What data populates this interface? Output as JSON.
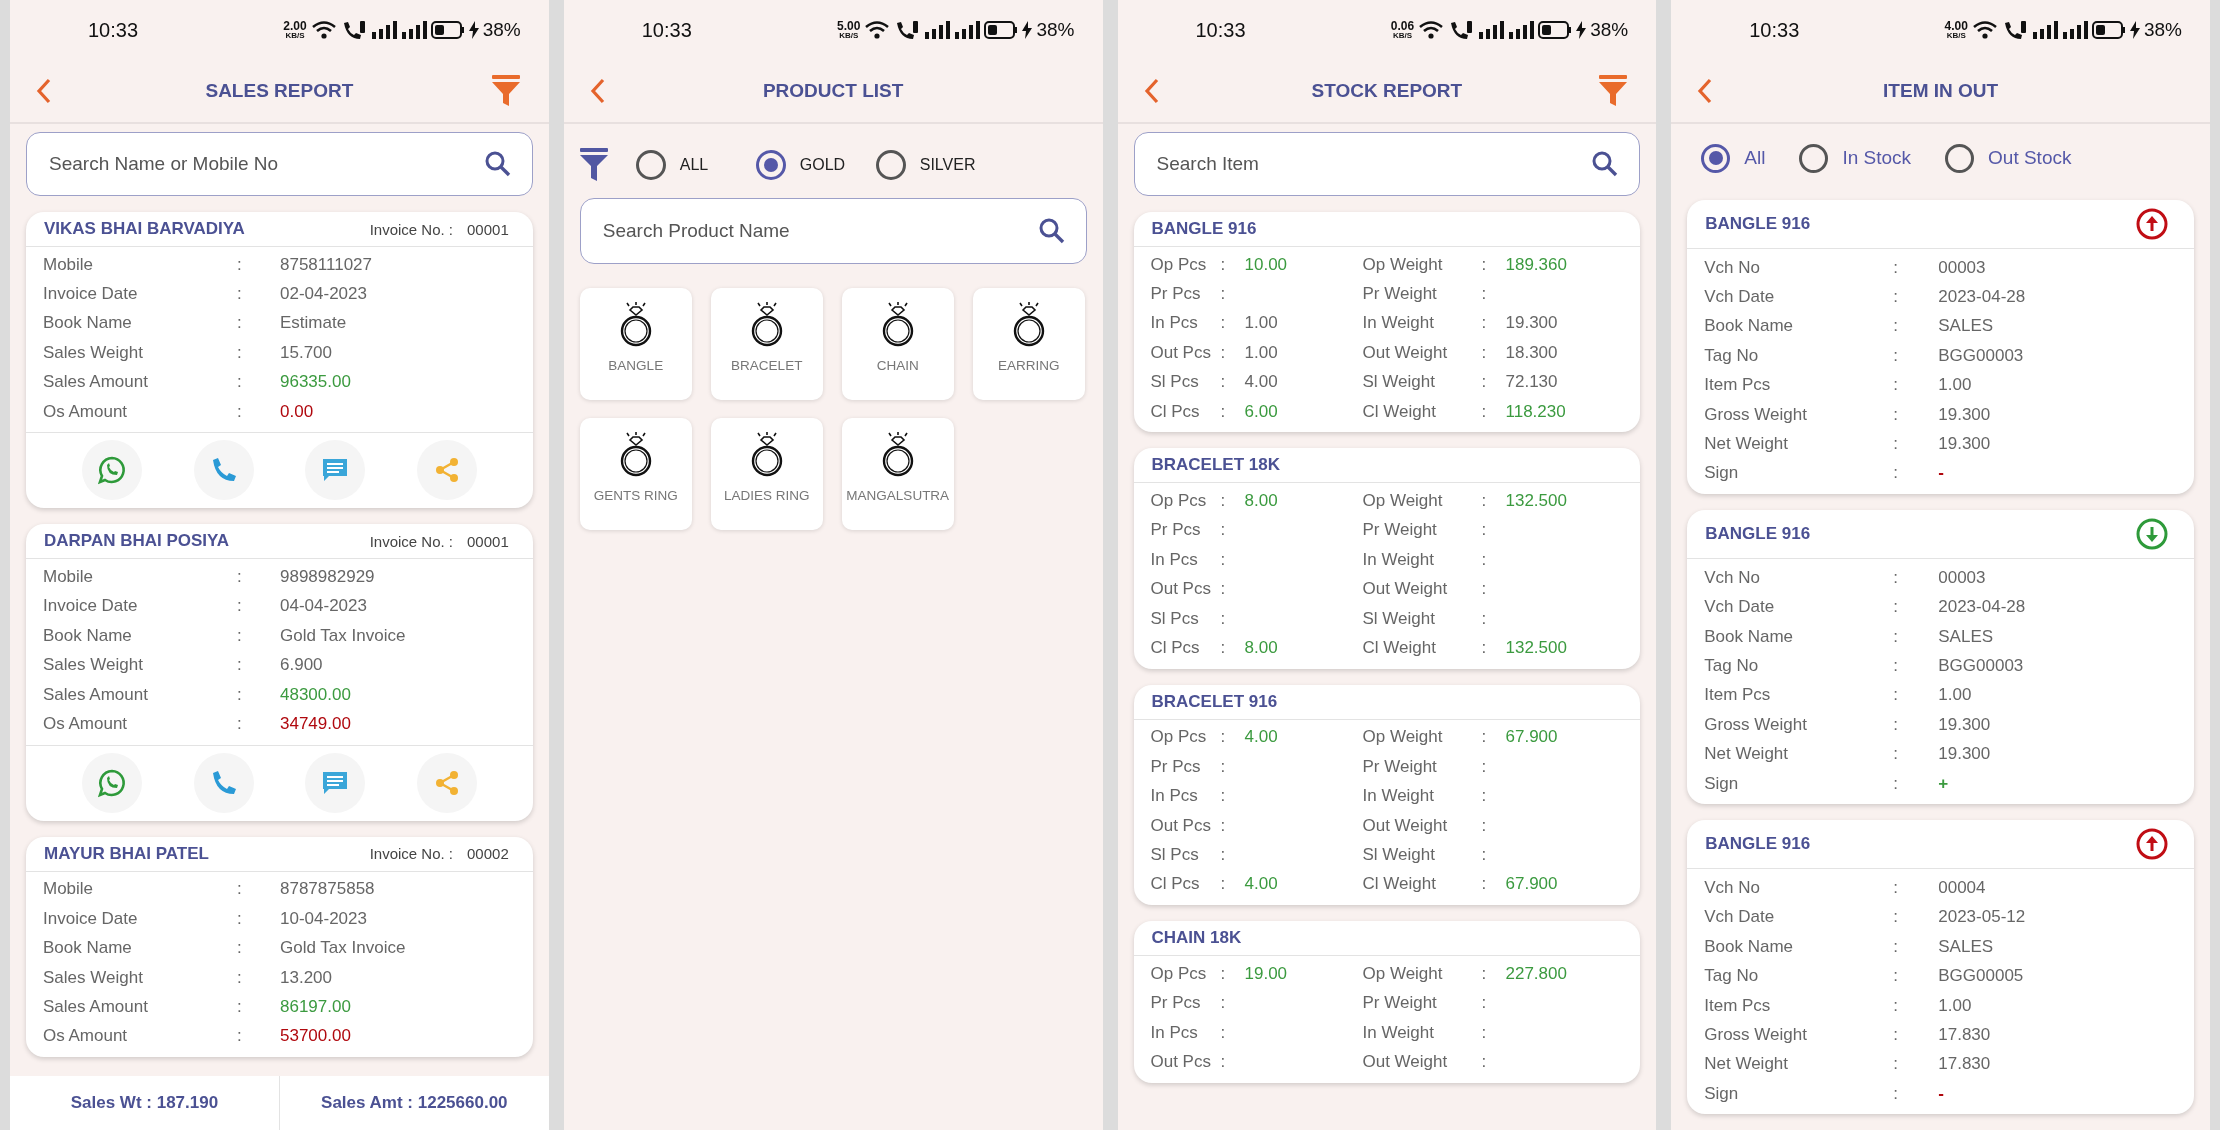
{
  "screens": [
    {
      "kind": "sales",
      "status": {
        "time": "10:33",
        "speed": "2.00",
        "speed_unit": "KB/S",
        "battery": "38%"
      },
      "title": "SALES REPORT",
      "filter_button": true,
      "search": {
        "placeholder": "Search Name or Mobile No"
      },
      "cards": [
        {
          "name": "VIKAS BHAI BARVADIYA",
          "invoice_label": "Invoice No. :",
          "invoice_no": "00001",
          "actions": [
            {
              "kind": "whatsapp"
            },
            {
              "kind": "call"
            },
            {
              "kind": "message"
            },
            {
              "kind": "share"
            }
          ],
          "fields": [
            {
              "label": "Mobile",
              "sep": ":",
              "value": "8758111027"
            },
            {
              "label": "Invoice Date",
              "sep": ":",
              "value": "02-04-2023"
            },
            {
              "label": "Book Name",
              "sep": ":",
              "value": "Estimate"
            },
            {
              "label": "Sales Weight",
              "sep": ":",
              "value": "15.700"
            },
            {
              "label": "Sales Amount",
              "sep": ":",
              "value": "96335.00",
              "color": "#3b9a3f"
            },
            {
              "label": "Os Amount",
              "sep": ":",
              "value": "0.00",
              "color": "#b0080e"
            }
          ]
        },
        {
          "name": "DARPAN BHAI POSIYA",
          "invoice_label": "Invoice No. :",
          "invoice_no": "00001",
          "actions": [
            {
              "kind": "whatsapp"
            },
            {
              "kind": "call"
            },
            {
              "kind": "message"
            },
            {
              "kind": "share"
            }
          ],
          "fields": [
            {
              "label": "Mobile",
              "sep": ":",
              "value": "9898982929"
            },
            {
              "label": "Invoice Date",
              "sep": ":",
              "value": "04-04-2023"
            },
            {
              "label": "Book Name",
              "sep": ":",
              "value": "Gold Tax Invoice"
            },
            {
              "label": "Sales Weight",
              "sep": ":",
              "value": "6.900"
            },
            {
              "label": "Sales Amount",
              "sep": ":",
              "value": "48300.00",
              "color": "#3b9a3f"
            },
            {
              "label": "Os Amount",
              "sep": ":",
              "value": "34749.00",
              "color": "#b0080e"
            }
          ]
        },
        {
          "name": "MAYUR BHAI PATEL",
          "invoice_label": "Invoice No. :",
          "invoice_no": "00002",
          "fields": [
            {
              "label": "Mobile",
              "sep": ":",
              "value": "8787875858"
            },
            {
              "label": "Invoice Date",
              "sep": ":",
              "value": "10-04-2023"
            },
            {
              "label": "Book Name",
              "sep": ":",
              "value": "Gold Tax Invoice"
            },
            {
              "label": "Sales Weight",
              "sep": ":",
              "value": "13.200"
            },
            {
              "label": "Sales Amount",
              "sep": ":",
              "value": "86197.00",
              "color": "#3b9a3f"
            },
            {
              "label": "Os Amount",
              "sep": ":",
              "value": "53700.00",
              "color": "#b0080e"
            }
          ]
        }
      ],
      "totals": [
        "Sales Wt : 187.190",
        "Sales Amt : 1225660.00"
      ]
    },
    {
      "kind": "products",
      "status": {
        "time": "10:33",
        "speed": "5.00",
        "speed_unit": "KB/S",
        "battery": "38%"
      },
      "title": "PRODUCT LIST",
      "filter_button": false,
      "radios": [
        {
          "label": "ALL",
          "selected": false
        },
        {
          "label": "GOLD",
          "selected": true
        },
        {
          "label": "SILVER",
          "selected": false
        }
      ],
      "search": {
        "placeholder": "Search Product Name"
      },
      "products": [
        "BANGLE",
        "BRACELET",
        "CHAIN",
        "EARRING",
        "GENTS RING",
        "LADIES RING",
        "MANGALSUTRA"
      ]
    },
    {
      "kind": "stock",
      "status": {
        "time": "10:33",
        "speed": "0.06",
        "speed_unit": "KB/S",
        "battery": "38%"
      },
      "title": "STOCK REPORT",
      "filter_button": true,
      "search": {
        "placeholder": "Search Item"
      },
      "items": [
        {
          "name": "BANGLE 916",
          "rows": [
            {
              "pcs_label": "Op Pcs",
              "pcs_sep": ":",
              "pcs": "10.00",
              "weight_label": "Op Weight",
              "weight_sep": ":",
              "weight": "189.360",
              "color": "#3b9a3f"
            },
            {
              "pcs_label": "Pr Pcs",
              "pcs_sep": ":",
              "weight_label": "Pr Weight",
              "weight_sep": ":"
            },
            {
              "pcs_label": "In Pcs",
              "pcs_sep": ":",
              "pcs": "1.00",
              "weight_label": "In Weight",
              "weight_sep": ":",
              "weight": "19.300"
            },
            {
              "pcs_label": "Out Pcs",
              "pcs_sep": ":",
              "pcs": "1.00",
              "weight_label": "Out Weight",
              "weight_sep": ":",
              "weight": "18.300"
            },
            {
              "pcs_label": "Sl Pcs",
              "pcs_sep": ":",
              "pcs": "4.00",
              "weight_label": "Sl Weight",
              "weight_sep": ":",
              "weight": "72.130"
            },
            {
              "pcs_label": "Cl Pcs",
              "pcs_sep": ":",
              "pcs": "6.00",
              "weight_label": "Cl Weight",
              "weight_sep": ":",
              "weight": "118.230",
              "color": "#3b9a3f"
            }
          ]
        },
        {
          "name": "BRACELET 18K",
          "rows": [
            {
              "pcs_label": "Op Pcs",
              "pcs_sep": ":",
              "pcs": "8.00",
              "weight_label": "Op Weight",
              "weight_sep": ":",
              "weight": "132.500",
              "color": "#3b9a3f"
            },
            {
              "pcs_label": "Pr Pcs",
              "pcs_sep": ":",
              "weight_label": "Pr Weight",
              "weight_sep": ":"
            },
            {
              "pcs_label": "In Pcs",
              "pcs_sep": ":",
              "weight_label": "In Weight",
              "weight_sep": ":"
            },
            {
              "pcs_label": "Out Pcs",
              "pcs_sep": ":",
              "weight_label": "Out Weight",
              "weight_sep": ":"
            },
            {
              "pcs_label": "Sl Pcs",
              "pcs_sep": ":",
              "weight_label": "Sl Weight",
              "weight_sep": ":"
            },
            {
              "pcs_label": "Cl Pcs",
              "pcs_sep": ":",
              "pcs": "8.00",
              "weight_label": "Cl Weight",
              "weight_sep": ":",
              "weight": "132.500",
              "color": "#3b9a3f"
            }
          ]
        },
        {
          "name": "BRACELET 916",
          "rows": [
            {
              "pcs_label": "Op Pcs",
              "pcs_sep": ":",
              "pcs": "4.00",
              "weight_label": "Op Weight",
              "weight_sep": ":",
              "weight": "67.900",
              "color": "#3b9a3f"
            },
            {
              "pcs_label": "Pr Pcs",
              "pcs_sep": ":",
              "weight_label": "Pr Weight",
              "weight_sep": ":"
            },
            {
              "pcs_label": "In Pcs",
              "pcs_sep": ":",
              "weight_label": "In Weight",
              "weight_sep": ":"
            },
            {
              "pcs_label": "Out Pcs",
              "pcs_sep": ":",
              "weight_label": "Out Weight",
              "weight_sep": ":"
            },
            {
              "pcs_label": "Sl Pcs",
              "pcs_sep": ":",
              "weight_label": "Sl Weight",
              "weight_sep": ":"
            },
            {
              "pcs_label": "Cl Pcs",
              "pcs_sep": ":",
              "pcs": "4.00",
              "weight_label": "Cl Weight",
              "weight_sep": ":",
              "weight": "67.900",
              "color": "#3b9a3f"
            }
          ]
        },
        {
          "name": "CHAIN 18K",
          "rows": [
            {
              "pcs_label": "Op Pcs",
              "pcs_sep": ":",
              "pcs": "19.00",
              "weight_label": "Op Weight",
              "weight_sep": ":",
              "weight": "227.800",
              "color": "#3b9a3f"
            },
            {
              "pcs_label": "Pr Pcs",
              "pcs_sep": ":",
              "weight_label": "Pr Weight",
              "weight_sep": ":"
            },
            {
              "pcs_label": "In Pcs",
              "pcs_sep": ":",
              "weight_label": "In Weight",
              "weight_sep": ":"
            },
            {
              "pcs_label": "Out Pcs",
              "pcs_sep": ":",
              "weight_label": "Out Weight",
              "weight_sep": ":"
            }
          ]
        }
      ]
    },
    {
      "kind": "inout",
      "status": {
        "time": "10:33",
        "speed": "4.00",
        "speed_unit": "KB/S",
        "battery": "38%"
      },
      "title": "ITEM IN OUT",
      "filter_button": false,
      "radios": [
        {
          "label": "All",
          "selected": true
        },
        {
          "label": "In Stock",
          "selected": false
        },
        {
          "label": "Out Stock",
          "selected": false
        }
      ],
      "entries": [
        {
          "name": "BANGLE 916",
          "kind": "up",
          "fields": [
            {
              "label": "Vch No",
              "sep": ":",
              "value": "00003"
            },
            {
              "label": "Vch Date",
              "sep": ":",
              "value": "2023-04-28"
            },
            {
              "label": "Book Name",
              "sep": ":",
              "value": "SALES"
            },
            {
              "label": "Tag No",
              "sep": ":",
              "value": "BGG00003"
            },
            {
              "label": "Item Pcs",
              "sep": ":",
              "value": "1.00"
            },
            {
              "label": "Gross Weight",
              "sep": ":",
              "value": "19.300"
            },
            {
              "label": "Net Weight",
              "sep": ":",
              "value": "19.300"
            },
            {
              "label": "Sign",
              "sep": ":",
              "value": "-",
              "color": "#b0080e"
            }
          ]
        },
        {
          "name": "BANGLE 916",
          "kind": "down",
          "fields": [
            {
              "label": "Vch No",
              "sep": ":",
              "value": "00003"
            },
            {
              "label": "Vch Date",
              "sep": ":",
              "value": "2023-04-28"
            },
            {
              "label": "Book Name",
              "sep": ":",
              "value": "SALES"
            },
            {
              "label": "Tag No",
              "sep": ":",
              "value": "BGG00003"
            },
            {
              "label": "Item Pcs",
              "sep": ":",
              "value": "1.00"
            },
            {
              "label": "Gross Weight",
              "sep": ":",
              "value": "19.300"
            },
            {
              "label": "Net Weight",
              "sep": ":",
              "value": "19.300"
            },
            {
              "label": "Sign",
              "sep": ":",
              "value": "+",
              "color": "#3b9a3f"
            }
          ]
        },
        {
          "name": "BANGLE 916",
          "kind": "up",
          "fields": [
            {
              "label": "Vch No",
              "sep": ":",
              "value": "00004"
            },
            {
              "label": "Vch Date",
              "sep": ":",
              "value": "2023-05-12"
            },
            {
              "label": "Book Name",
              "sep": ":",
              "value": "SALES"
            },
            {
              "label": "Tag No",
              "sep": ":",
              "value": "BGG00005"
            },
            {
              "label": "Item Pcs",
              "sep": ":",
              "value": "1.00"
            },
            {
              "label": "Gross Weight",
              "sep": ":",
              "value": "17.830"
            },
            {
              "label": "Net Weight",
              "sep": ":",
              "value": "17.830"
            },
            {
              "label": "Sign",
              "sep": ":",
              "value": "-",
              "color": "#b0080e"
            }
          ]
        }
      ]
    }
  ]
}
